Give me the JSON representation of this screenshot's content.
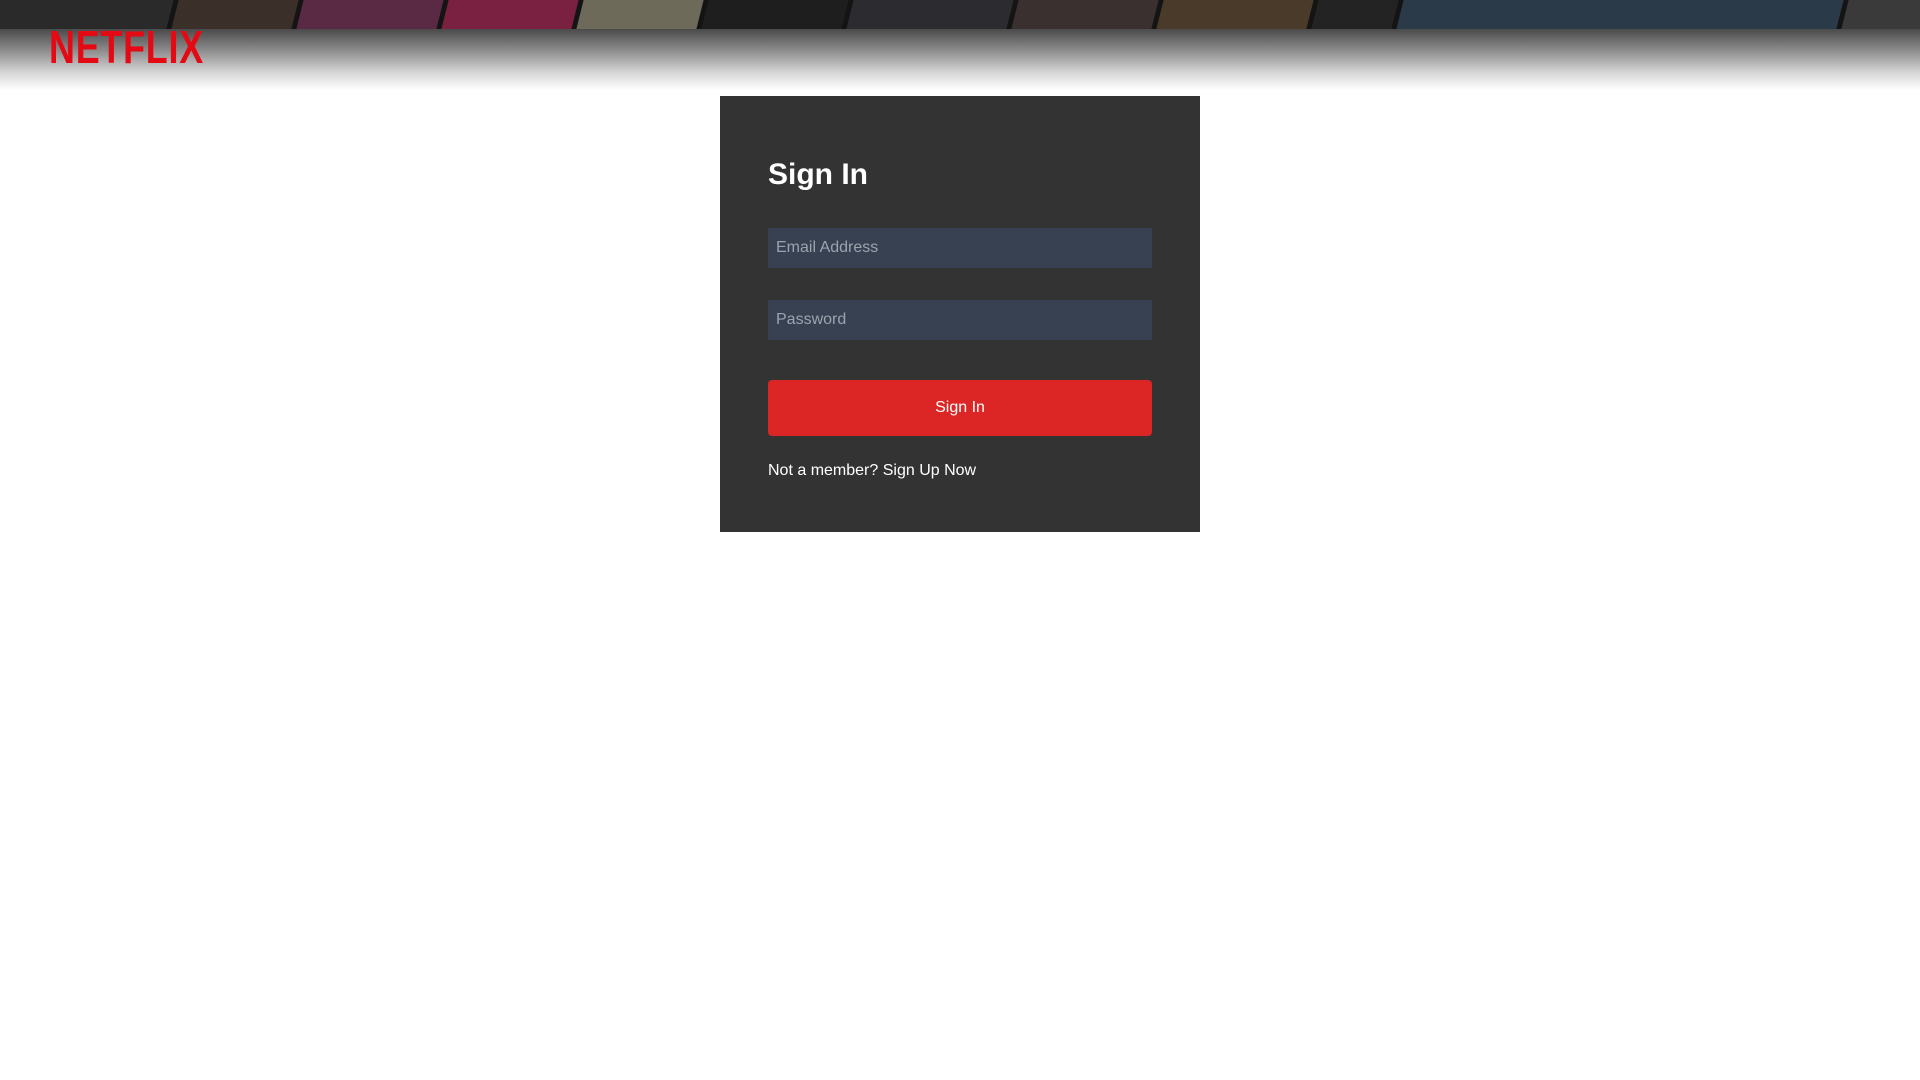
{
  "header": {
    "logo_text": "NETFLIX",
    "brand_color": "#e50914"
  },
  "login": {
    "title": "Sign In",
    "email_placeholder": "Email Address",
    "email_value": "",
    "password_placeholder": "Password",
    "password_value": "",
    "submit_label": "Sign In",
    "signup_prompt": "Not a member?",
    "signup_link": "Sign Up Now"
  },
  "colors": {
    "card_bg": "#333333",
    "input_bg": "#374151",
    "button_bg": "#dc2626",
    "page_bg": "#ffffff"
  }
}
